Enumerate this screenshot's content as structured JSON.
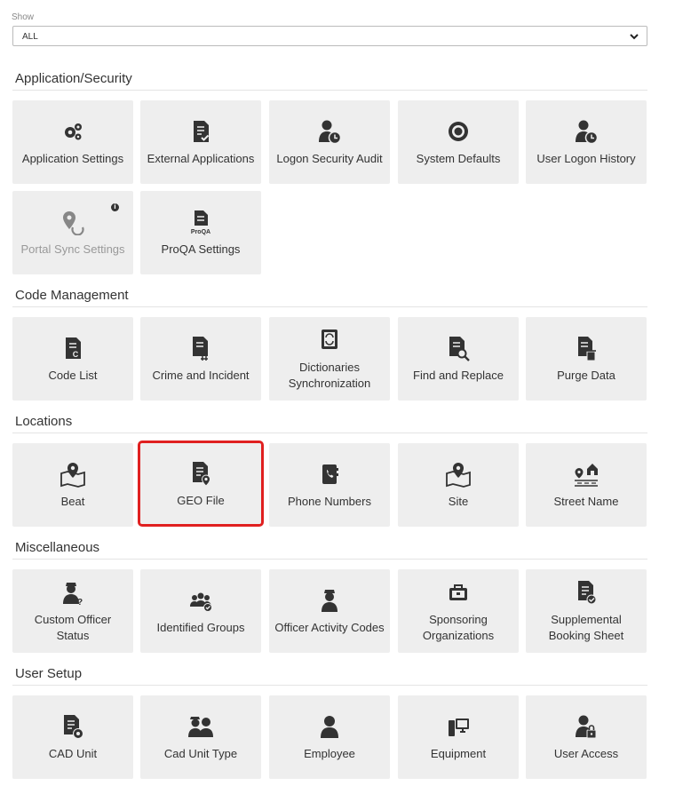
{
  "filter": {
    "label": "Show",
    "value": "ALL"
  },
  "sections": [
    {
      "title": "Application/Security",
      "items": [
        "Application Settings",
        "External Applications",
        "Logon Security Audit",
        "System Defaults",
        "User Logon History",
        "Portal Sync Settings",
        "ProQA Settings"
      ]
    },
    {
      "title": "Code Management",
      "items": [
        "Code List",
        "Crime and Incident",
        "Dictionaries Synchronization",
        "Find and Replace",
        "Purge Data"
      ]
    },
    {
      "title": "Locations",
      "items": [
        "Beat",
        "GEO File",
        "Phone Numbers",
        "Site",
        "Street Name"
      ]
    },
    {
      "title": "Miscellaneous",
      "items": [
        "Custom Officer Status",
        "Identified Groups",
        "Officer Activity Codes",
        "Sponsoring Organizations",
        "Supplemental Booking Sheet"
      ]
    },
    {
      "title": "User Setup",
      "items": [
        "CAD Unit",
        "Cad Unit Type",
        "Employee",
        "Equipment",
        "User Access"
      ]
    }
  ],
  "icons": {
    "application-settings": "gears-icon",
    "external-applications": "document-check-icon",
    "logon-security-audit": "user-clock-icon",
    "system-defaults": "gear-icon",
    "user-logon-history": "user-clock-icon",
    "portal-sync-settings": "map-pin-sync-icon",
    "proqa-settings": "proqa-document-icon",
    "code-list": "document-code-icon",
    "crime-and-incident": "document-hash-icon",
    "dictionaries-synchronization": "book-sync-icon",
    "find-and-replace": "document-search-icon",
    "purge-data": "document-trash-icon",
    "beat": "map-pin-icon",
    "geo-file": "document-pin-icon",
    "phone-numbers": "phone-book-icon",
    "site": "map-pin-icon",
    "street-name": "street-house-icon",
    "custom-officer-status": "officer-question-icon",
    "identified-groups": "user-group-check-icon",
    "officer-activity-codes": "officer-icon",
    "sponsoring-organizations": "briefcase-icon",
    "supplemental-booking-sheet": "document-check-icon",
    "cad-unit": "document-gear-icon",
    "cad-unit-type": "officer-pair-icon",
    "employee": "user-icon",
    "equipment": "computer-icon",
    "user-access": "user-lock-icon"
  },
  "selected_item": "GEO File",
  "info_badge": "i",
  "colors": {
    "tile_bg": "#eeeeee",
    "selected_outline": "#e02020",
    "icon": "#333333",
    "disabled_text": "#999999"
  }
}
